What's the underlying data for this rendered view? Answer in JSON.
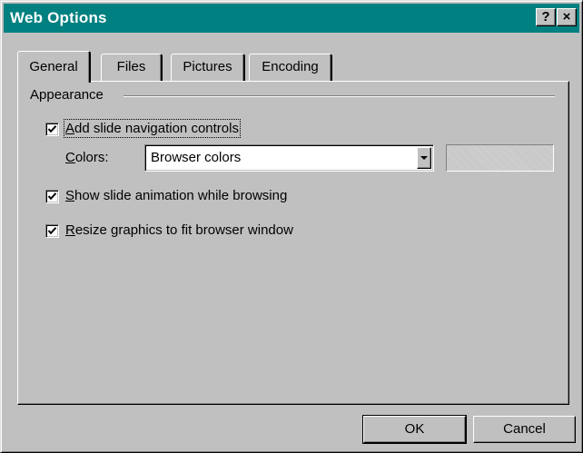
{
  "window": {
    "title": "Web Options",
    "help_label": "?",
    "close_label": "×"
  },
  "tabs": [
    {
      "label": "General",
      "active": true
    },
    {
      "label": "Files",
      "active": false
    },
    {
      "label": "Pictures",
      "active": false
    },
    {
      "label": "Encoding",
      "active": false
    }
  ],
  "appearance": {
    "group_label": "Appearance",
    "nav_controls": {
      "mnemonic": "A",
      "rest": "dd slide navigation controls",
      "checked": true
    },
    "colors": {
      "mnemonic": "C",
      "rest": "olors:",
      "selected": "Browser colors"
    },
    "show_animation": {
      "mnemonic": "S",
      "rest": "how slide animation while browsing",
      "checked": true
    },
    "resize_graphics": {
      "mnemonic": "R",
      "rest": "esize graphics to fit browser window",
      "checked": true
    }
  },
  "buttons": {
    "ok": "OK",
    "cancel": "Cancel"
  },
  "colors": {
    "titlebar": "#008080",
    "face": "#c0c0c0"
  }
}
